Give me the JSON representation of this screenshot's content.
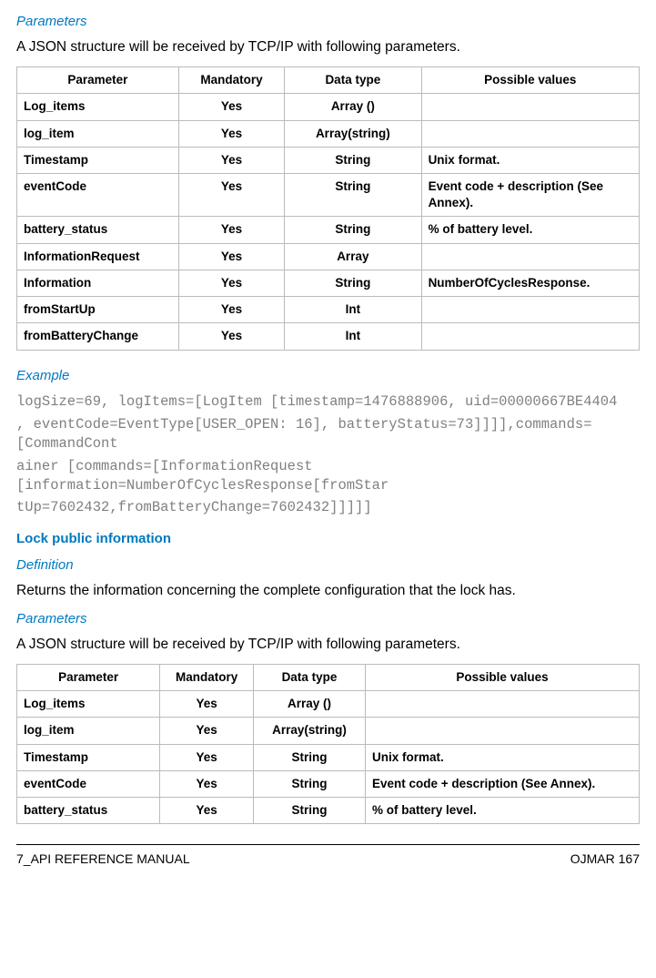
{
  "section1": {
    "title": "Parameters",
    "intro": "A JSON structure will be received by TCP/IP with following parameters.",
    "headers": [
      "Parameter",
      "Mandatory",
      "Data type",
      "Possible values"
    ],
    "rows": [
      {
        "p": "Log_items",
        "m": "Yes",
        "d": "Array ()",
        "v": ""
      },
      {
        "p": "log_item",
        "m": "Yes",
        "d": "Array(string)",
        "v": ""
      },
      {
        "p": "Timestamp",
        "m": "Yes",
        "d": "String",
        "v": "Unix format."
      },
      {
        "p": "eventCode",
        "m": "Yes",
        "d": "String",
        "v": "Event code + description (See Annex)."
      },
      {
        "p": "battery_status",
        "m": "Yes",
        "d": "String",
        "v": "% of battery level."
      },
      {
        "p": "InformationRequest",
        "m": "Yes",
        "d": "Array",
        "v": ""
      },
      {
        "p": "Information",
        "m": "Yes",
        "d": "String",
        "v": "NumberOfCyclesResponse."
      },
      {
        "p": "fromStartUp",
        "m": "Yes",
        "d": "Int",
        "v": ""
      },
      {
        "p": "fromBatteryChange",
        "m": "Yes",
        "d": "Int",
        "v": ""
      }
    ]
  },
  "example": {
    "title": "Example",
    "lines": [
      "logSize=69, logItems=[LogItem [timestamp=1476888906, uid=00000667BE4404",
      ", eventCode=EventType[USER_OPEN: 16], batteryStatus=73]]]],commands=[CommandCont",
      "ainer [commands=[InformationRequest [information=NumberOfCyclesResponse[fromStar",
      "tUp=7602432,fromBatteryChange=7602432]]]]]"
    ]
  },
  "section2": {
    "title": "Lock public information",
    "def_title": "Definition",
    "def_text": "Returns the information concerning the complete configuration that the lock has.",
    "param_title": "Parameters",
    "param_intro": "A JSON structure will be received by TCP/IP with following parameters.",
    "headers": [
      "Parameter",
      "Mandatory",
      "Data type",
      "Possible values"
    ],
    "rows": [
      {
        "p": "Log_items",
        "m": "Yes",
        "d": "Array ()",
        "v": ""
      },
      {
        "p": "log_item",
        "m": "Yes",
        "d": "Array(string)",
        "v": ""
      },
      {
        "p": "Timestamp",
        "m": "Yes",
        "d": "String",
        "v": "Unix format."
      },
      {
        "p": "eventCode",
        "m": "Yes",
        "d": "String",
        "v": "Event code + description (See Annex)."
      },
      {
        "p": "battery_status",
        "m": "Yes",
        "d": "String",
        "v": "% of battery level."
      }
    ]
  },
  "footer": {
    "left": "7_API REFERENCE MANUAL",
    "right": "OJMAR 167"
  }
}
